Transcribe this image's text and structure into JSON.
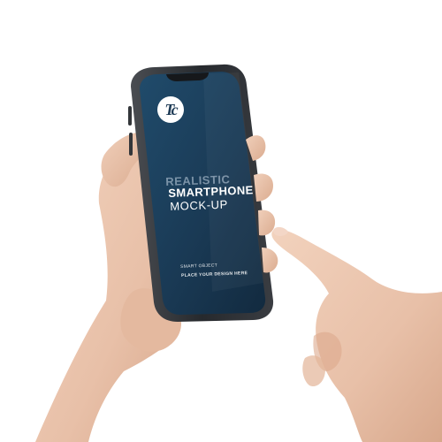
{
  "logo": {
    "text": "Tc"
  },
  "screen": {
    "line1": "REALISTIC",
    "line2": "SMARTPHONE",
    "line3": "MOCK-UP",
    "small1": "SMART OBJECT",
    "small2": "PLACE YOUR DESIGN HERE"
  },
  "colors": {
    "screen_top": "#1f4a6a",
    "screen_bottom": "#132a40",
    "phone_frame": "#2a2d31",
    "skin": "#e9c3ab"
  }
}
